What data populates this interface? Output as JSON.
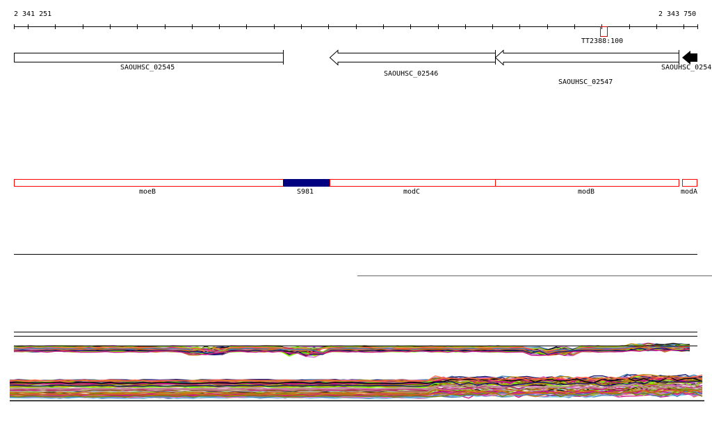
{
  "ruler": {
    "start_label": "2 341 251",
    "end_label": "2 343 750"
  },
  "marker": {
    "label": "TT2388:100",
    "color": "#cc0000"
  },
  "genes": [
    {
      "label": "SAOUHSC_02545"
    },
    {
      "label": "SAOUHSC_02546"
    },
    {
      "label": "SAOUHSC_02547"
    },
    {
      "label": "SAOUHSC_0254"
    }
  ],
  "operon_features": [
    {
      "label": "moeB"
    },
    {
      "label": "S981"
    },
    {
      "label": "modC"
    },
    {
      "label": "modB"
    },
    {
      "label": "modA"
    }
  ],
  "colors": {
    "feature_outline": "#ff0000",
    "srna_fill": "#000080",
    "profile_palette": [
      "#d2691e",
      "#808000",
      "#7fff00",
      "#87ceeb",
      "#4682b4",
      "#c71585",
      "#bc8f8f",
      "#000000",
      "#ff6347",
      "#191970",
      "#b8860b",
      "#da70d6",
      "#9acd32",
      "#8b4513"
    ]
  }
}
